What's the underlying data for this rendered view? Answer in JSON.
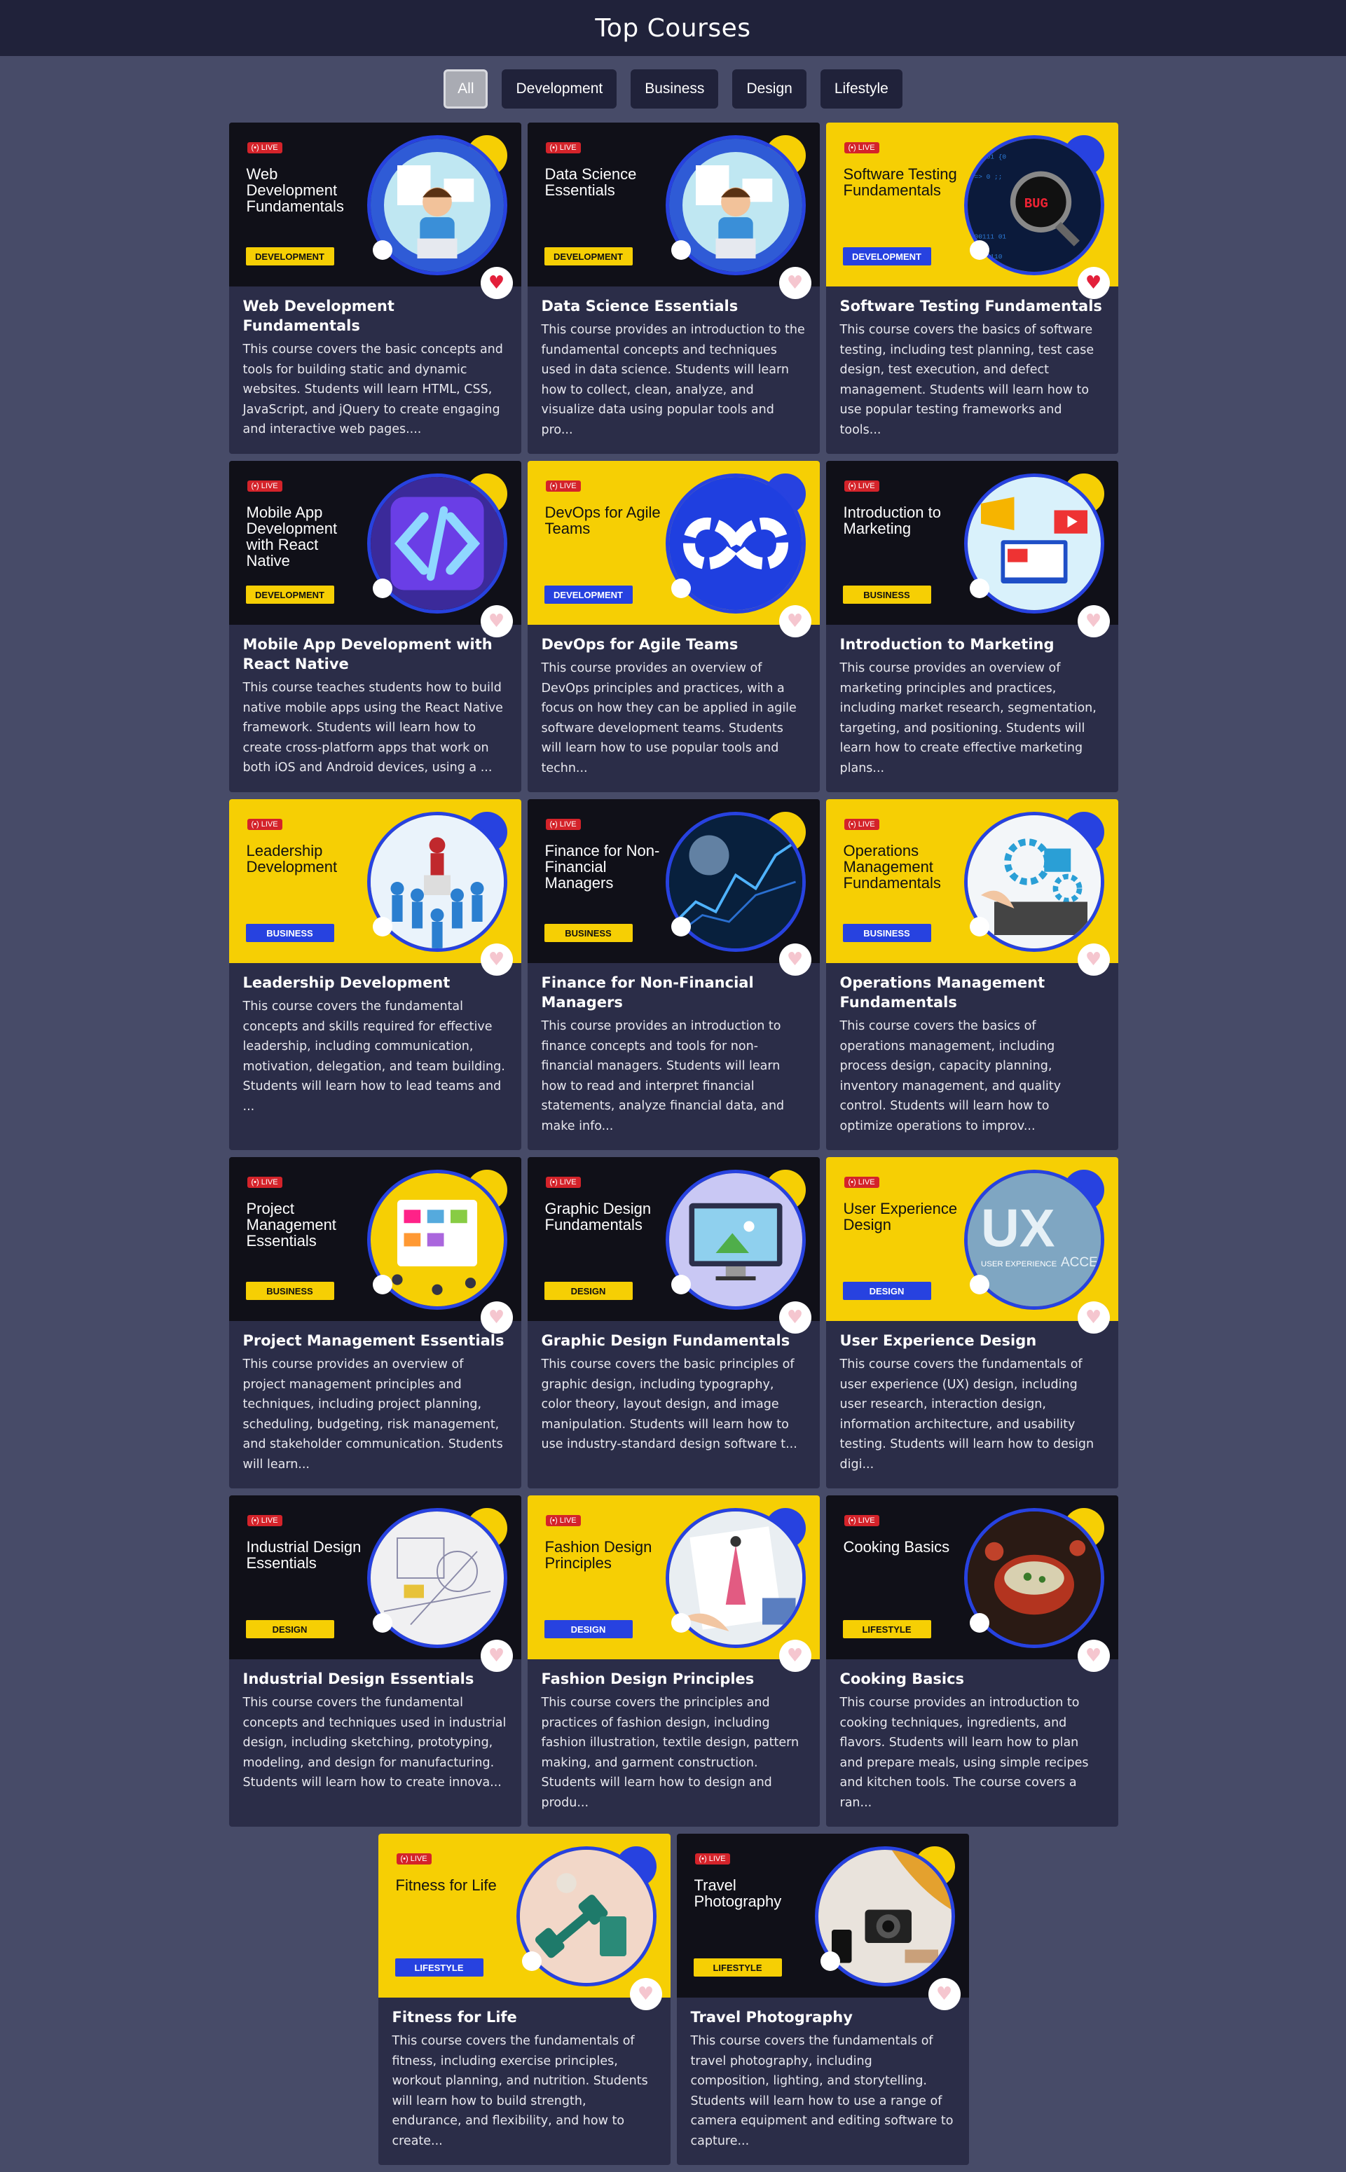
{
  "header": {
    "title": "Top Courses"
  },
  "filters": [
    "All",
    "Development",
    "Business",
    "Design",
    "Lifestyle"
  ],
  "badge_label": "(•) LIVE",
  "courses": [
    {
      "banner_title": "Web Development Fundamentals",
      "category": "DEVELOPMENT",
      "theme": "dark",
      "title": "Web Development Fundamentals",
      "description": "This course covers the basic concepts and tools for building static and dynamic websites. Students will learn HTML, CSS, JavaScript, and jQuery to create engaging and interactive web pages....",
      "favorite": true,
      "icon": "developer-illustration-icon"
    },
    {
      "banner_title": "Data Science Essentials",
      "category": "DEVELOPMENT",
      "theme": "dark",
      "title": "Data Science Essentials",
      "description": "This course provides an introduction to the fundamental concepts and techniques used in data science. Students will learn how to collect, clean, analyze, and visualize data using popular tools and pro...",
      "favorite": false,
      "icon": "developer-illustration-icon"
    },
    {
      "banner_title": "Software Testing Fundamentals",
      "category": "DEVELOPMENT",
      "theme": "yellow",
      "title": "Software Testing Fundamentals",
      "description": "This course covers the basics of software testing, including test planning, test case design, test execution, and defect management. Students will learn how to use popular testing frameworks and tools...",
      "favorite": true,
      "icon": "bug-magnifier-icon"
    },
    {
      "banner_title": "Mobile App Development with React Native",
      "category": "DEVELOPMENT",
      "theme": "dark",
      "title": "Mobile App Development with React Native",
      "description": "This course teaches students how to build native mobile apps using the React Native framework. Students will learn how to create cross-platform apps that work on both iOS and Android devices, using a ...",
      "favorite": false,
      "icon": "code-brackets-icon"
    },
    {
      "banner_title": "DevOps for Agile Teams",
      "category": "DEVELOPMENT",
      "theme": "yellow",
      "title": "DevOps for Agile Teams",
      "description": "This course provides an overview of DevOps principles and practices, with a focus on how they can be applied in agile software development teams. Students will learn how to use popular tools and techn...",
      "favorite": false,
      "icon": "infinity-loop-icon"
    },
    {
      "banner_title": "Introduction to Marketing",
      "category": "BUSINESS",
      "theme": "dark",
      "title": "Introduction to Marketing",
      "description": "This course provides an overview of marketing principles and practices, including market research, segmentation, targeting, and positioning. Students will learn how to create effective marketing plans...",
      "favorite": false,
      "icon": "megaphone-icon"
    },
    {
      "banner_title": "Leadership Development",
      "category": "BUSINESS",
      "theme": "yellow",
      "title": "Leadership Development",
      "description": "This course covers the fundamental concepts and skills required for effective leadership, including communication, motivation, delegation, and team building. Students will learn how to lead teams and ...",
      "favorite": false,
      "icon": "leader-crowd-icon"
    },
    {
      "banner_title": "Finance for Non-Financial Managers",
      "category": "BUSINESS",
      "theme": "dark",
      "title": "Finance for Non-Financial Managers",
      "description": "This course provides an introduction to finance concepts and tools for non-financial managers. Students will learn how to read and interpret financial statements, analyze financial data, and make info...",
      "favorite": false,
      "icon": "finance-chart-icon"
    },
    {
      "banner_title": "Operations Management Fundamentals",
      "category": "BUSINESS",
      "theme": "yellow",
      "title": "Operations Management Fundamentals",
      "description": "This course covers the basics of operations management, including process design, capacity planning, inventory management, and quality control. Students will learn how to optimize operations to improv...",
      "favorite": false,
      "icon": "gears-laptop-icon"
    },
    {
      "banner_title": "Project Management Essentials",
      "category": "BUSINESS",
      "theme": "dark",
      "title": "Project Management Essentials",
      "description": "This course provides an overview of project management principles and techniques, including project planning, scheduling, budgeting, risk management, and stakeholder communication. Students will learn...",
      "favorite": false,
      "icon": "project-board-icon"
    },
    {
      "banner_title": "Graphic Design Fundamentals",
      "category": "DESIGN",
      "theme": "dark",
      "title": "Graphic Design Fundamentals",
      "description": "This course covers the basic principles of graphic design, including typography, color theory, layout design, and image manipulation. Students will learn how to use industry-standard design software t...",
      "favorite": false,
      "icon": "monitor-image-icon"
    },
    {
      "banner_title": "User Experience Design",
      "category": "DESIGN",
      "theme": "yellow",
      "title": "User Experience Design",
      "description": "This course covers the fundamentals of user experience (UX) design, including user research, interaction design, information architecture, and usability testing. Students will learn how to design digi...",
      "favorite": false,
      "icon": "ux-text-icon"
    },
    {
      "banner_title": "Industrial Design Essentials",
      "category": "DESIGN",
      "theme": "dark",
      "title": "Industrial Design Essentials",
      "description": "This course covers the fundamental concepts and techniques used in industrial design, including sketching, prototyping, modeling, and design for manufacturing. Students will learn how to create innova...",
      "favorite": false,
      "icon": "blueprint-icon"
    },
    {
      "banner_title": "Fashion Design Principles",
      "category": "DESIGN",
      "theme": "yellow",
      "title": "Fashion Design Principles",
      "description": "This course covers the principles and practices of fashion design, including fashion illustration, textile design, pattern making, and garment construction. Students will learn how to design and produ...",
      "favorite": false,
      "icon": "fashion-sketch-icon"
    },
    {
      "banner_title": "Cooking Basics",
      "category": "LIFESTYLE",
      "theme": "dark",
      "title": "Cooking Basics",
      "description": "This course provides an introduction to cooking techniques, ingredients, and flavors. Students will learn how to plan and prepare meals, using simple recipes and kitchen tools. The course covers a ran...",
      "favorite": false,
      "icon": "cooking-pot-icon"
    },
    {
      "banner_title": "Fitness for Life",
      "category": "LIFESTYLE",
      "theme": "yellow",
      "title": "Fitness for Life",
      "description": "This course covers the fundamentals of fitness, including exercise principles, workout planning, and nutrition. Students will learn how to build strength, endurance, and flexibility, and how to create...",
      "favorite": false,
      "icon": "dumbbell-icon"
    },
    {
      "banner_title": "Travel Photography",
      "category": "LIFESTYLE",
      "theme": "dark",
      "title": "Travel Photography",
      "description": "This course covers the fundamentals of travel photography, including composition, lighting, and storytelling. Students will learn how to use a range of camera equipment and editing software to capture...",
      "favorite": false,
      "icon": "camera-icon"
    }
  ]
}
